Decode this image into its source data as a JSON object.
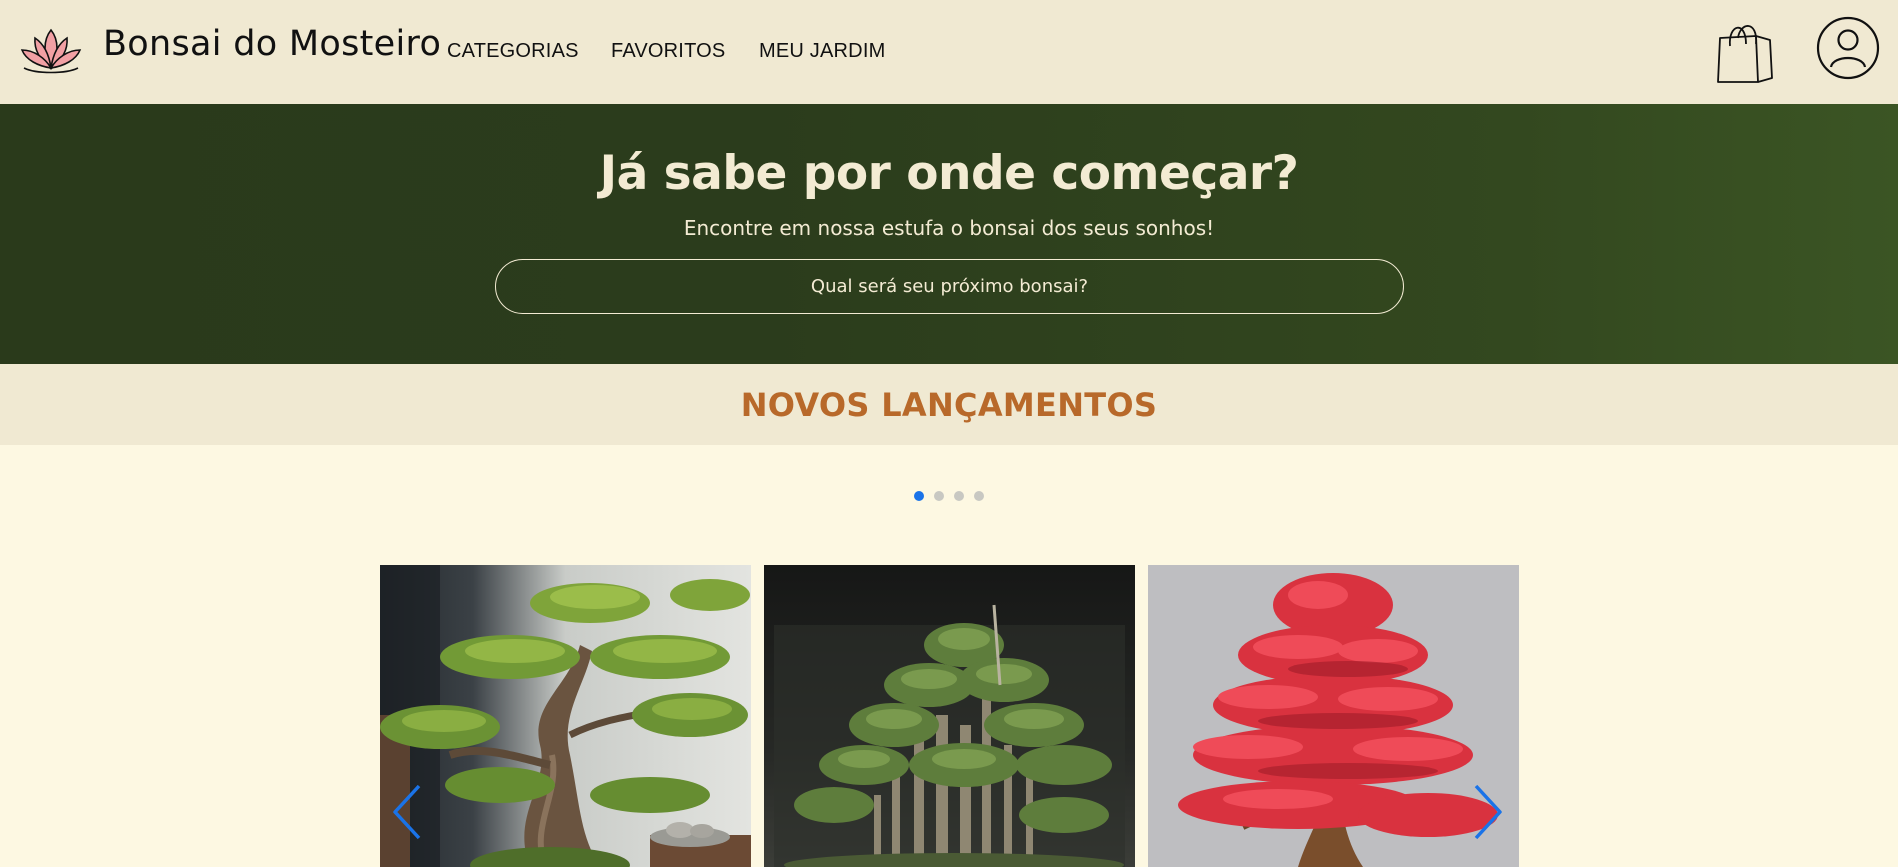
{
  "header": {
    "brand": "Bonsai do Mosteiro",
    "nav": {
      "categories": "CATEGORIAS",
      "favorites": "FAVORITOS",
      "garden": "MEU JARDIM"
    },
    "icons": [
      "lotus-logo-icon",
      "shopping-bag-icon",
      "user-account-icon"
    ]
  },
  "hero": {
    "title": "Já sabe por onde começar?",
    "subtitle": "Encontre em nossa estufa o bonsai dos seus sonhos!",
    "search_placeholder": "Qual será seu próximo bonsai?"
  },
  "section": {
    "title": "NOVOS LANÇAMENTOS"
  },
  "carousel": {
    "dot_count": 4,
    "active_index": 0,
    "items": [
      {
        "image": "pine-bonsai-photo"
      },
      {
        "image": "forest-bonsai-photo"
      },
      {
        "image": "red-azalea-bonsai-photo"
      }
    ],
    "icons": [
      "chevron-left-icon",
      "chevron-right-icon"
    ]
  },
  "colors": {
    "header_bg": "#f0e9d2",
    "page_bg": "#fdf8e2",
    "hero_bg": "#2a3a1b",
    "hero_text": "#f3ebd3",
    "section_title": "#b8692a",
    "accent_blue": "#1a73e8"
  }
}
